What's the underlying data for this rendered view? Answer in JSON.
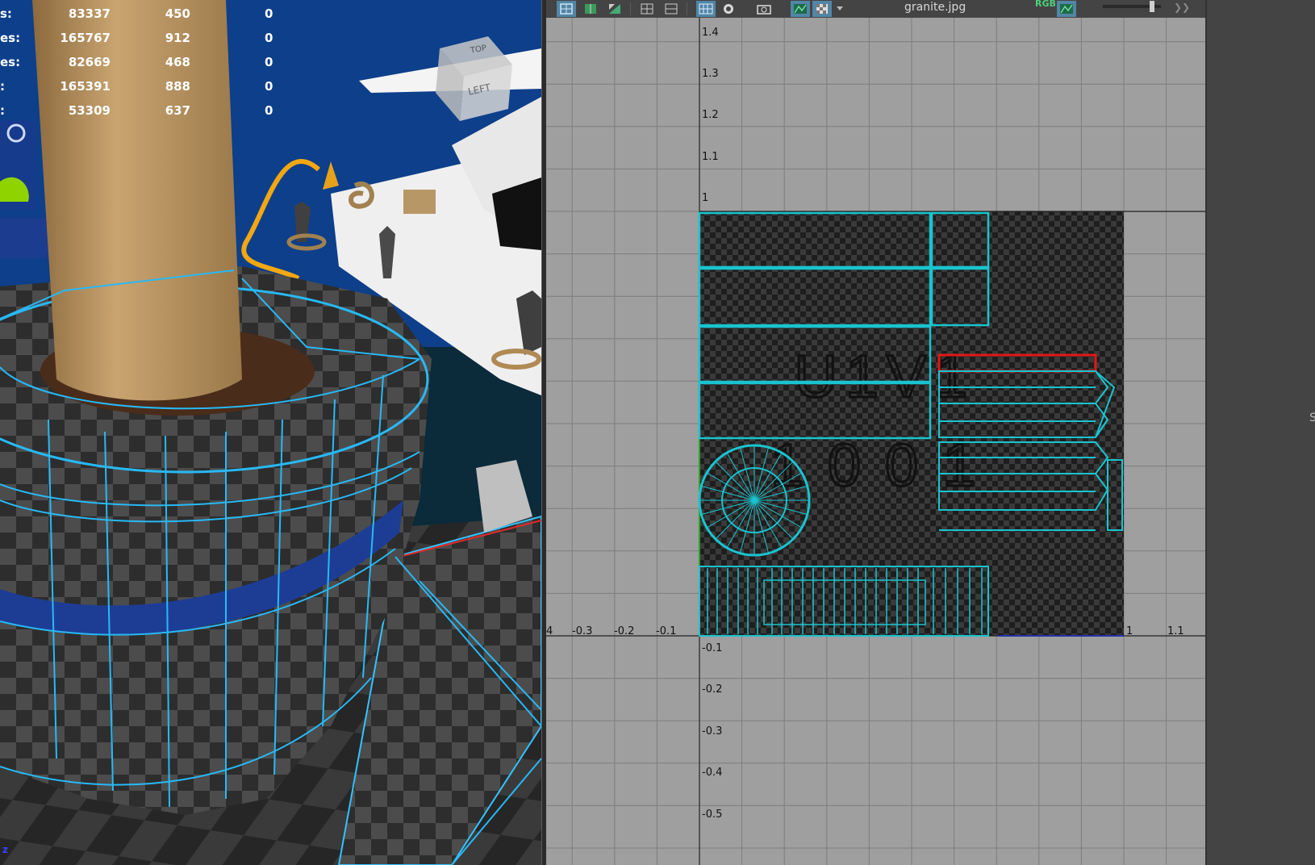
{
  "hud": {
    "rows": [
      {
        "label": "s:",
        "v1": "83337",
        "v2": "450",
        "v3": "0"
      },
      {
        "label": "es:",
        "v1": "165767",
        "v2": "912",
        "v3": "0"
      },
      {
        "label": "es:",
        "v1": "82669",
        "v2": "468",
        "v3": "0"
      },
      {
        "label": ":",
        "v1": "165391",
        "v2": "888",
        "v3": "0"
      },
      {
        "label": ":",
        "v1": "53309",
        "v2": "637",
        "v3": "0"
      }
    ]
  },
  "viewcube": {
    "top_label": "TOP",
    "left_label": "LEFT"
  },
  "axis_indicator": "z",
  "uv_toolbar": {
    "texture_name": "granite.jpg",
    "channel_label": "RGB"
  },
  "uv_grid": {
    "x_ticks": [
      "-0.3",
      "-0.2",
      "-0.1",
      "1",
      "1.1"
    ],
    "y_ticks": [
      "1.4",
      "1.3",
      "1.2",
      "1.1",
      "1",
      "-0.1",
      "-0.2",
      "-0.3",
      "-0.4",
      "-0.5"
    ],
    "edge_label": "4"
  },
  "uv_tile": {
    "name": "U1V1",
    "number": "1001"
  },
  "right_panel": {
    "letter": "S"
  },
  "colors": {
    "uv_shell": "#19c4cf",
    "uv_selected": "#e01818",
    "wireframe": "#28b9f5",
    "grid_bg": "#9f9f9f"
  }
}
